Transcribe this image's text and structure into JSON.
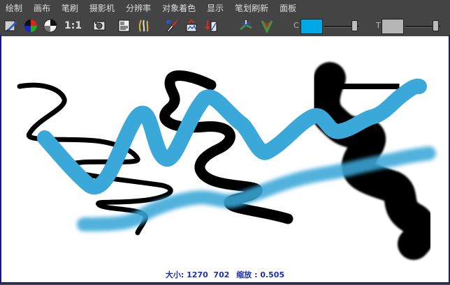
{
  "menu": [
    {
      "label": "绘制"
    },
    {
      "label": "画布"
    },
    {
      "label": "笔刷"
    },
    {
      "label": "摄影机"
    },
    {
      "label": "分辨率"
    },
    {
      "label": "对象着色"
    },
    {
      "label": "显示"
    },
    {
      "label": "笔划刷新"
    },
    {
      "label": "面板"
    }
  ],
  "toolbar": {
    "ratio_label": "1:1",
    "color_slider_label": "C",
    "transparency_slider_label": "T",
    "color_value": 0.85,
    "transparency_value": 0.85
  },
  "colors": {
    "color_swatch": "#00a8e6",
    "transparency_swatch": "#b5b5b5",
    "stroke_black": "#000000",
    "stroke_blue": "#3aa8d8"
  },
  "status": {
    "size_label": "大小:",
    "size_value": "1270  702",
    "zoom_label": "缩放 :",
    "zoom_value": "0.505"
  }
}
